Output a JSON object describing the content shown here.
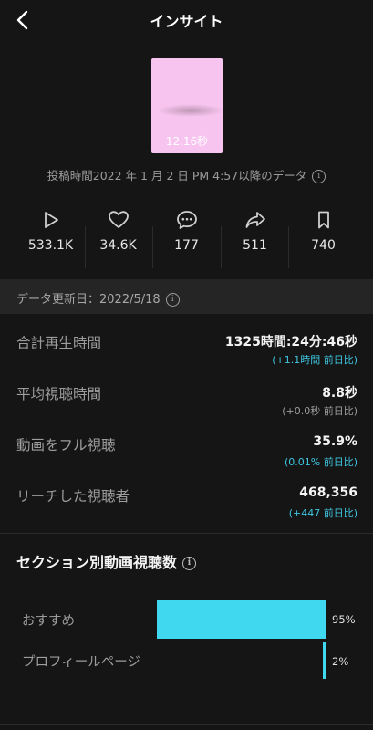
{
  "header": {
    "title": "インサイト",
    "back_icon": "chevron-left-icon"
  },
  "video": {
    "duration": "12.16秒",
    "thumbnail_color": "#f7c4ef"
  },
  "posted_info": "投稿時間2022 年 1 月 2 日 PM 4:57以降のデータ",
  "stats": {
    "plays": "533.1K",
    "likes": "34.6K",
    "comments": "177",
    "shares": "511",
    "saves": "740"
  },
  "update_bar": {
    "text": "データ更新日：2022/5/18"
  },
  "metrics": [
    {
      "label": "合計再生時間",
      "value": "1325時間:24分:46秒",
      "delta": "(+1.1時間 前日比)"
    },
    {
      "label": "平均視聴時間",
      "value": "8.8秒",
      "delta": "(+0.0秒 前日比)"
    },
    {
      "label": "動画をフル視聴",
      "value": "35.9%",
      "delta": "(0.01% 前日比)"
    },
    {
      "label": "リーチした視聴者",
      "value": "468,356",
      "delta": "(+447 前日比)"
    }
  ],
  "traffic": {
    "title": "セクション別動画視聴数",
    "sources": [
      {
        "label": "おすすめ",
        "percent_label": "95%",
        "value": 95
      },
      {
        "label": "プロフィールページ",
        "percent_label": "2%",
        "value": 2
      }
    ]
  },
  "colors": {
    "accent": "#3fd8ee",
    "background": "#151515",
    "delta_positive": "#3ec6e0"
  }
}
